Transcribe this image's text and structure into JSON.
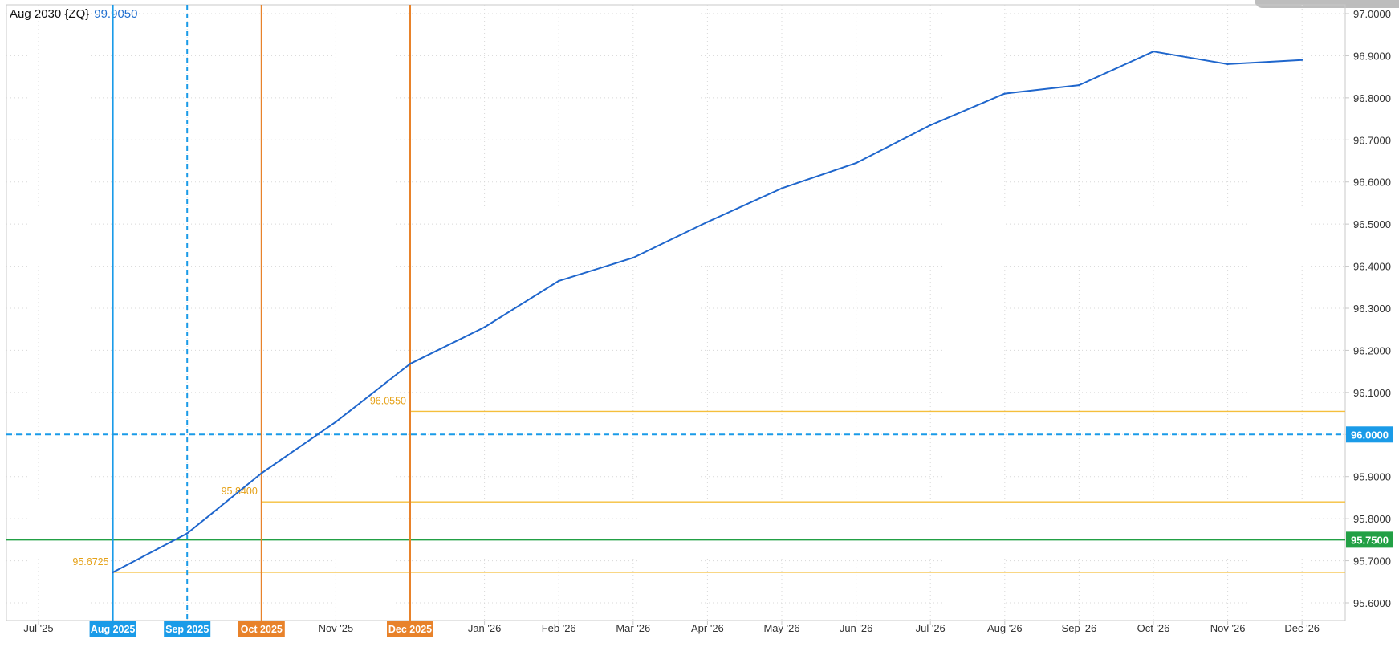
{
  "header": {
    "instrument": "Aug 2030 {ZQ}",
    "last_value": "99.9050"
  },
  "colors": {
    "series": "#1f66cc",
    "blue_marker": "#1a9be8",
    "orange_marker": "#e8822a",
    "level_line": "#f5bf3c",
    "level_text": "#e5a117",
    "green_line": "#22a045",
    "grid": "#d8d8d8",
    "axis": "#c8c8c8"
  },
  "chart_data": {
    "type": "line",
    "x": [
      "Aug '25",
      "Sep '25",
      "Oct '25",
      "Nov '25",
      "Dec '25",
      "Jan '26",
      "Feb '26",
      "Mar '26",
      "Apr '26",
      "May '26",
      "Jun '26",
      "Jul '26",
      "Aug '26",
      "Sep '26",
      "Oct '26",
      "Nov '26",
      "Dec '26"
    ],
    "series": [
      {
        "values": [
          95.6725,
          95.765,
          95.908,
          96.03,
          96.168,
          96.255,
          96.365,
          96.42,
          96.505,
          96.585,
          96.645,
          96.735,
          96.81,
          96.83,
          96.91,
          96.88,
          96.89
        ]
      }
    ],
    "x_ticks": [
      "Jul '25",
      "Aug 2025",
      "Sep 2025",
      "Oct 2025",
      "Nov '25",
      "Dec 2025",
      "Jan '26",
      "Feb '26",
      "Mar '26",
      "Apr '26",
      "May '26",
      "Jun '26",
      "Jul '26",
      "Aug '26",
      "Sep '26",
      "Oct '26",
      "Nov '26",
      "Dec '26"
    ],
    "y_ticks": [
      "97.0000",
      "96.9000",
      "96.8000",
      "96.7000",
      "96.6000",
      "96.5000",
      "96.4000",
      "96.3000",
      "96.2000",
      "96.1000",
      "96.0000",
      "95.9000",
      "95.8000",
      "95.7000",
      "95.6000"
    ],
    "ylim": [
      95.6,
      97.0
    ],
    "grid": true,
    "vertical_markers": [
      {
        "label": "Aug 2025",
        "x_index": 0,
        "style": "solid",
        "color": "blue"
      },
      {
        "label": "Sep 2025",
        "x_index": 1,
        "style": "dashed",
        "color": "blue"
      },
      {
        "label": "Oct 2025",
        "x_index": 2,
        "style": "solid",
        "color": "orange"
      },
      {
        "label": "Dec 2025",
        "x_index": 4,
        "style": "solid",
        "color": "orange"
      }
    ],
    "horizontal_markers": [
      {
        "label": "96.0000",
        "value": 96.0,
        "style": "dashed",
        "color": "blue"
      },
      {
        "label": "95.7500",
        "value": 95.75,
        "style": "solid",
        "color": "green"
      }
    ],
    "level_lines": [
      {
        "label": "95.6725",
        "value": 95.6725,
        "from_index": 0
      },
      {
        "label": "95.8400",
        "value": 95.84,
        "from_index": 2
      },
      {
        "label": "96.0550",
        "value": 96.055,
        "from_index": 4
      }
    ]
  }
}
